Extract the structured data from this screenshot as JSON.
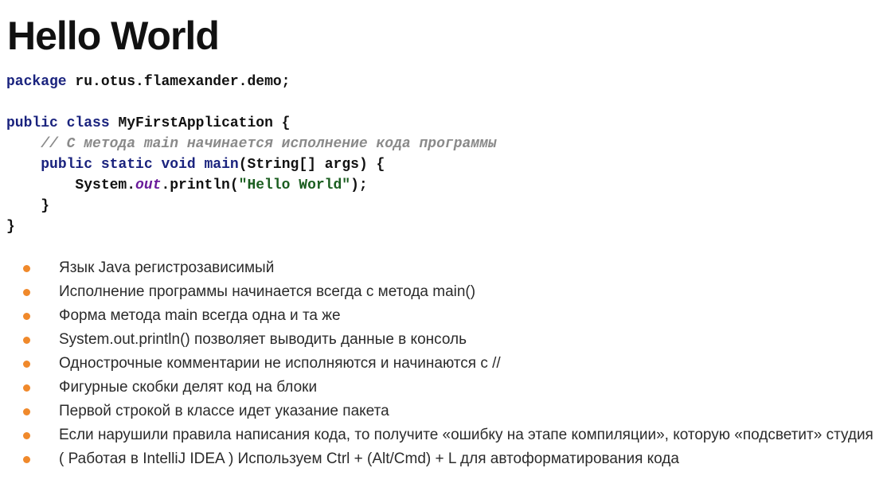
{
  "slide": {
    "title": "Hello World"
  },
  "code": {
    "lines": [
      [
        {
          "t": "kw",
          "v": "package"
        },
        {
          "t": "plain",
          "v": " ru.otus.flamexander.demo;"
        }
      ],
      [],
      [
        {
          "t": "kw",
          "v": "public"
        },
        {
          "t": "plain",
          "v": " "
        },
        {
          "t": "kw",
          "v": "class"
        },
        {
          "t": "plain",
          "v": " MyFirstApplication {"
        }
      ],
      [
        {
          "t": "plain",
          "v": "    "
        },
        {
          "t": "comment",
          "v": "// С метода main начинается исполнение кода программы"
        }
      ],
      [
        {
          "t": "plain",
          "v": "    "
        },
        {
          "t": "kw",
          "v": "public"
        },
        {
          "t": "plain",
          "v": " "
        },
        {
          "t": "kw",
          "v": "static"
        },
        {
          "t": "plain",
          "v": " "
        },
        {
          "t": "kw",
          "v": "void"
        },
        {
          "t": "plain",
          "v": " "
        },
        {
          "t": "kw",
          "v": "main"
        },
        {
          "t": "plain",
          "v": "(String[] args) {"
        }
      ],
      [
        {
          "t": "plain",
          "v": "        System."
        },
        {
          "t": "field",
          "v": "out"
        },
        {
          "t": "plain",
          "v": ".println("
        },
        {
          "t": "str",
          "v": "\"Hello World\""
        },
        {
          "t": "plain",
          "v": ");"
        }
      ],
      [
        {
          "t": "plain",
          "v": "    }"
        }
      ],
      [
        {
          "t": "plain",
          "v": "}"
        }
      ]
    ]
  },
  "bullets": [
    "Язык Java регистрозависимый",
    "Исполнение программы начинается всегда с метода main()",
    "Форма метода main всегда одна и та же",
    "System.out.println() позволяет выводить данные в консоль",
    "Однострочные комментарии не исполняются и начинаются с //",
    "Фигурные скобки делят код на блоки",
    "Первой строкой в классе идет указание пакета",
    "Если нарушили правила написания кода, то получите «ошибку на этапе компиляции», которую «подсветит» студия",
    "( Работая в IntelliJ IDEA ) Используем Ctrl + (Alt/Cmd) + L для автоформатирования кода"
  ],
  "colors": {
    "bullet_dot": "#f0892b",
    "keyword": "#1a237e",
    "string": "#1b5e20",
    "comment": "#8a8a8a",
    "field": "#6a1b9a"
  }
}
